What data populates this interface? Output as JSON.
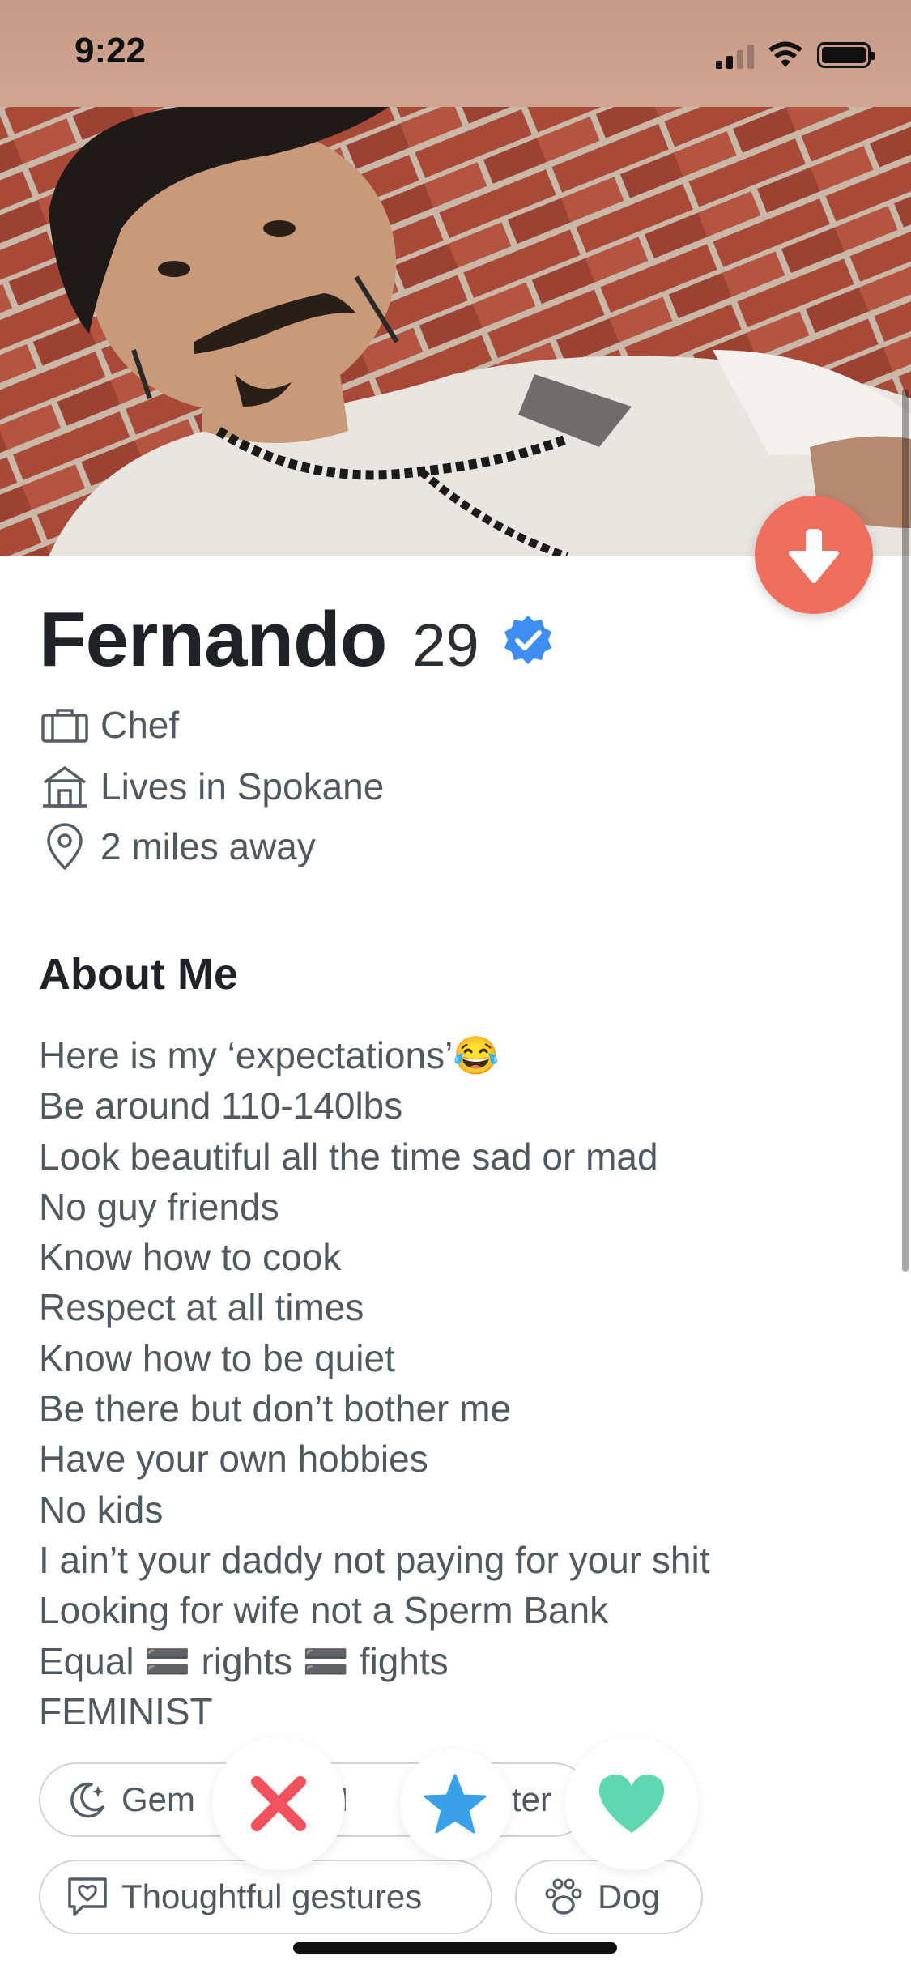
{
  "status_bar": {
    "time": "9:22"
  },
  "profile": {
    "name": "Fernando",
    "age": "29",
    "details": [
      {
        "icon": "briefcase-icon",
        "text": "Chef"
      },
      {
        "icon": "home-icon",
        "text": "Lives in Spokane"
      },
      {
        "icon": "location-pin-icon",
        "text": "2 miles away"
      }
    ]
  },
  "about": {
    "title": "About Me",
    "lines": [
      "Here is my ‘expectations’😂",
      "Be around 110-140lbs",
      "Look beautiful all the time sad or mad",
      "No guy friends",
      "Know how to cook",
      "Respect at all times",
      "Know how to be quiet",
      "Be there but don’t bother me",
      "Have your own hobbies",
      "No kids",
      "I ain’t your daddy not paying for your shit",
      "Looking for wife not a Sperm Bank",
      "Equal 🟰 rights 🟰 fights",
      "FEMINIST"
    ]
  },
  "chips": [
    {
      "icon": "zodiac-moon-icon",
      "label": "Gem"
    },
    {
      "icon": "chat-icon",
      "label": "I"
    },
    {
      "icon": "chip-icon",
      "label": "ter"
    },
    {
      "icon": "gift-icon",
      "label": "Thoughtful gestures"
    },
    {
      "icon": "paw-icon",
      "label": "Dog"
    }
  ],
  "colors": {
    "collapse_button": "#ef6f5f",
    "verified_badge": "#3d8ef0",
    "nope": "#f2515e",
    "super_like": "#3aa0e8",
    "like": "#5fd7b0"
  }
}
